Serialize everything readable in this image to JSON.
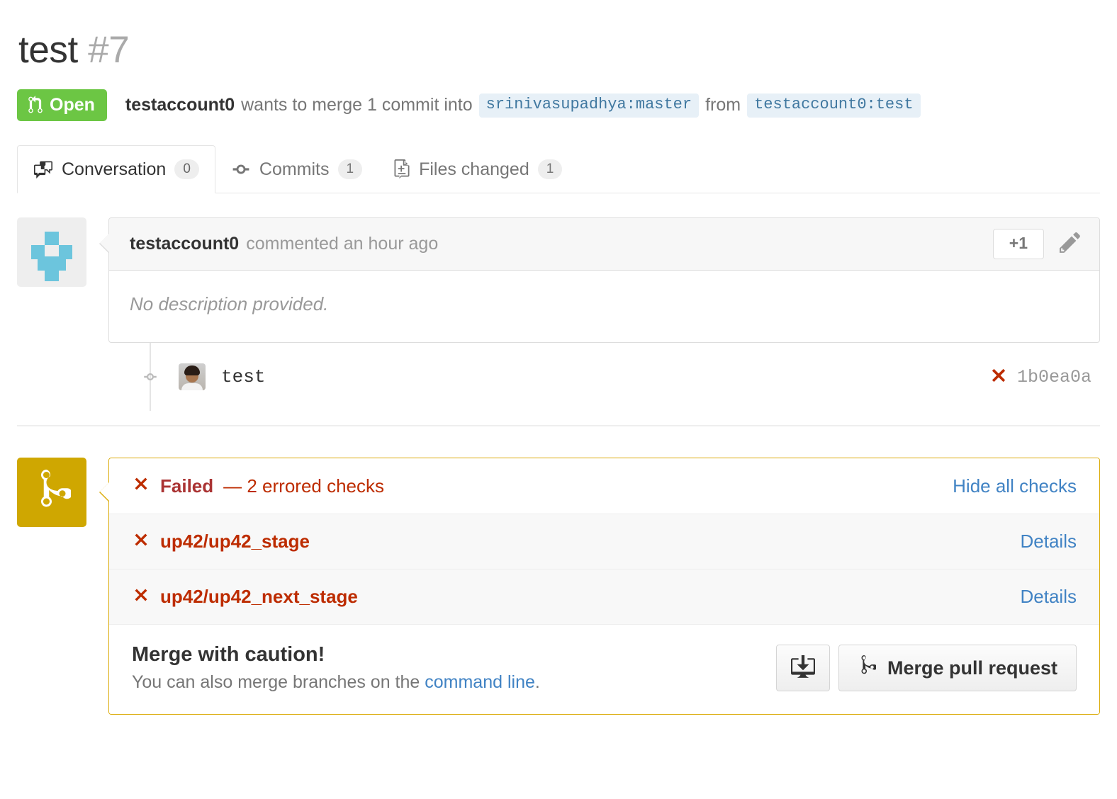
{
  "header": {
    "title": "test",
    "number": "#7",
    "state_label": "Open",
    "state_color": "#6cc644",
    "author": "testaccount0",
    "merge_text_1": "wants to merge 1 commit into",
    "base_branch": "srinivasupadhya:master",
    "merge_text_2": "from",
    "head_branch": "testaccount0:test"
  },
  "tabs": [
    {
      "label": "Conversation",
      "count": "0",
      "icon": "comment-discussion-icon",
      "active": true
    },
    {
      "label": "Commits",
      "count": "1",
      "icon": "git-commit-icon",
      "active": false
    },
    {
      "label": "Files changed",
      "count": "1",
      "icon": "diff-file-icon",
      "active": false
    }
  ],
  "comment": {
    "author": "testaccount0",
    "timestamp": "commented an hour ago",
    "reaction_label": "+1",
    "body": "No description provided."
  },
  "commit": {
    "message": "test",
    "sha": "1b0ea0a",
    "status_icon": "x-icon"
  },
  "merge_status": {
    "border_color": "#dbab09",
    "avatar_color": "#cfa701",
    "status_bold": "Failed",
    "status_rest": "— 2 errored checks",
    "toggle_label": "Hide all checks",
    "checks": [
      {
        "name": "up42/up42_stage",
        "details_label": "Details",
        "state": "error"
      },
      {
        "name": "up42/up42_next_stage",
        "details_label": "Details",
        "state": "error"
      }
    ],
    "footer": {
      "heading": "Merge with caution!",
      "description_prefix": "You can also merge branches on the ",
      "description_link": "command line",
      "description_suffix": ".",
      "desktop_button_icon": "desktop-download-icon",
      "merge_button_label": "Merge pull request"
    }
  },
  "colors": {
    "red": "#bd2c00",
    "blue": "#4183c4",
    "green": "#6cc644",
    "gold": "#dbab09"
  }
}
